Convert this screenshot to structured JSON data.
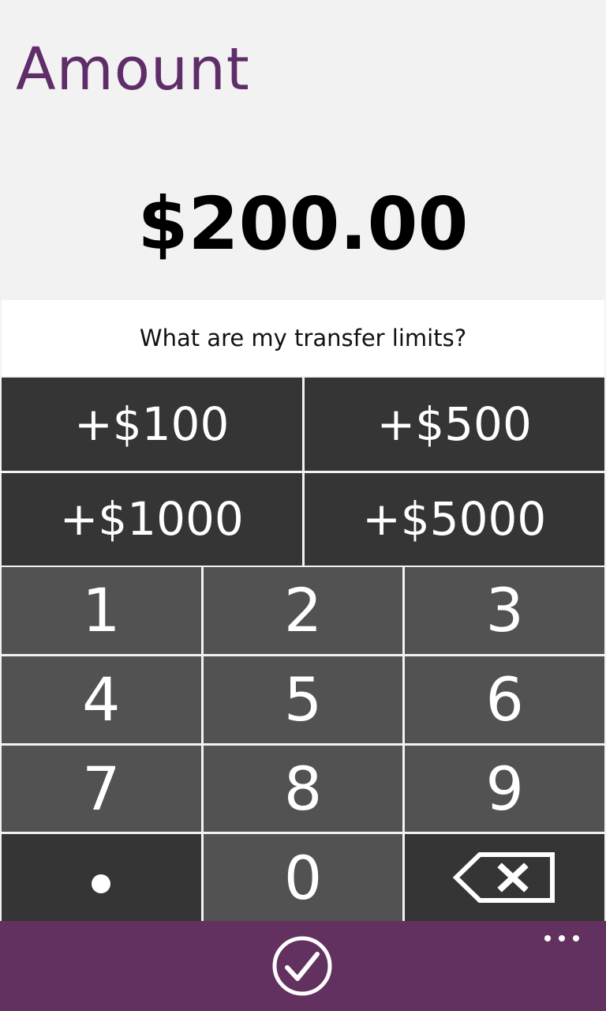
{
  "header": {
    "title": "Amount"
  },
  "amount": {
    "value": "$200.00"
  },
  "limits_link": {
    "label": "What are my transfer limits?"
  },
  "quick_add": [
    {
      "label": "+$100"
    },
    {
      "label": "+$500"
    },
    {
      "label": "+$1000"
    },
    {
      "label": "+$5000"
    }
  ],
  "keypad": {
    "keys": [
      "1",
      "2",
      "3",
      "4",
      "5",
      "6",
      "7",
      "8",
      "9",
      "0"
    ],
    "decimal_icon": "decimal-point-dot",
    "backspace_icon": "backspace-x-icon"
  },
  "app_bar": {
    "confirm_icon": "check-circle-icon",
    "more_icon": "ellipsis-icon",
    "color": "#62315f"
  },
  "colors": {
    "title": "#5f2d6a",
    "quick_add_bg": "#353535",
    "key_bg": "#525252",
    "page_bg": "#f2f2f2"
  }
}
